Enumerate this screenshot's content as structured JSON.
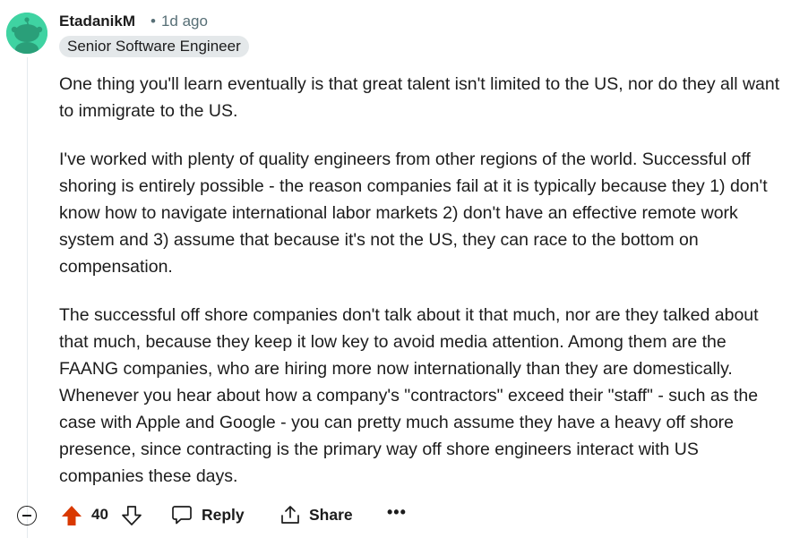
{
  "comment": {
    "author": "EtadanikM",
    "separator": "•",
    "time": "1d ago",
    "flair": "Senior Software Engineer",
    "paragraphs": [
      "One thing you'll learn eventually is that great talent isn't limited to the US, nor do they all want to immigrate to the US.",
      "I've worked with plenty of quality engineers from other regions of the world. Successful off shoring is entirely possible - the reason companies fail at it is typically because they 1) don't know how to navigate international labor markets 2) don't have an effective remote work system and 3) assume that because it's not the US, they can race to the bottom on compensation.",
      "The successful off shore companies don't talk about it that much, nor are they talked about that much, because they keep it low key to avoid media attention. Among them are the FAANG companies, who are hiring more now internationally than they are domestically. Whenever you hear about how a company's \"contractors\" exceed their \"staff\" - such as the case with Apple and Google - you can pretty much assume they have a heavy off shore presence, since contracting is the primary way off shore engineers interact with US companies these days."
    ]
  },
  "actions": {
    "score": "40",
    "upvoted": true,
    "reply_label": "Reply",
    "share_label": "Share",
    "more_label": "•••"
  },
  "colors": {
    "upvote_active": "#d93900",
    "avatar_bg": "#3fd3a2",
    "flair_bg": "#e4e8ea",
    "meta_text": "#576f76"
  },
  "icons": {
    "avatar": "snoo-avatar",
    "collapse": "minus-circle-icon",
    "upvote": "arrow-up-icon",
    "downvote": "arrow-down-icon",
    "reply": "comment-bubble-icon",
    "share": "share-icon",
    "more": "ellipsis-icon"
  }
}
